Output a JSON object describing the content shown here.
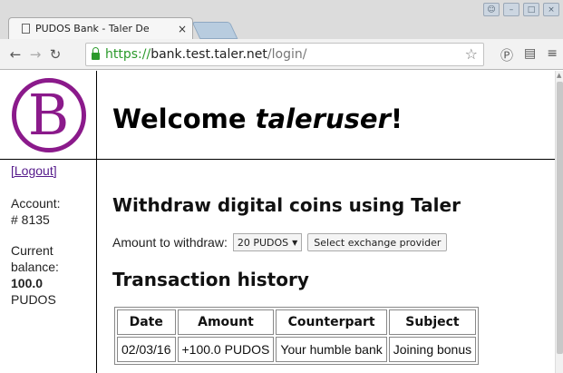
{
  "browser": {
    "tab_title": "PUDOS Bank - Taler De",
    "tab_close": "×",
    "url_scheme": "https://",
    "url_host": "bank.test.taler.net",
    "url_path": "/login/"
  },
  "logo": {
    "letter": "B",
    "color": "#8b1a8b"
  },
  "sidebar": {
    "logout": "[Logout]",
    "account_label": "Account:",
    "account_number": "# 8135",
    "balance_label_1": "Current",
    "balance_label_2": "balance:",
    "balance_value": "100.0",
    "balance_currency": "PUDOS"
  },
  "header": {
    "welcome_prefix": "Welcome ",
    "username": "taleruser",
    "welcome_suffix": "!"
  },
  "withdraw": {
    "heading": "Withdraw digital coins using Taler",
    "amount_label": "Amount to withdraw:",
    "amount_selected": "20 PUDOS",
    "exchange_button": "Select exchange provider"
  },
  "history": {
    "heading": "Transaction history",
    "columns": [
      "Date",
      "Amount",
      "Counterpart",
      "Subject"
    ],
    "rows": [
      [
        "02/03/16",
        "+100.0 PUDOS",
        "Your humble bank",
        "Joining bonus"
      ]
    ]
  }
}
